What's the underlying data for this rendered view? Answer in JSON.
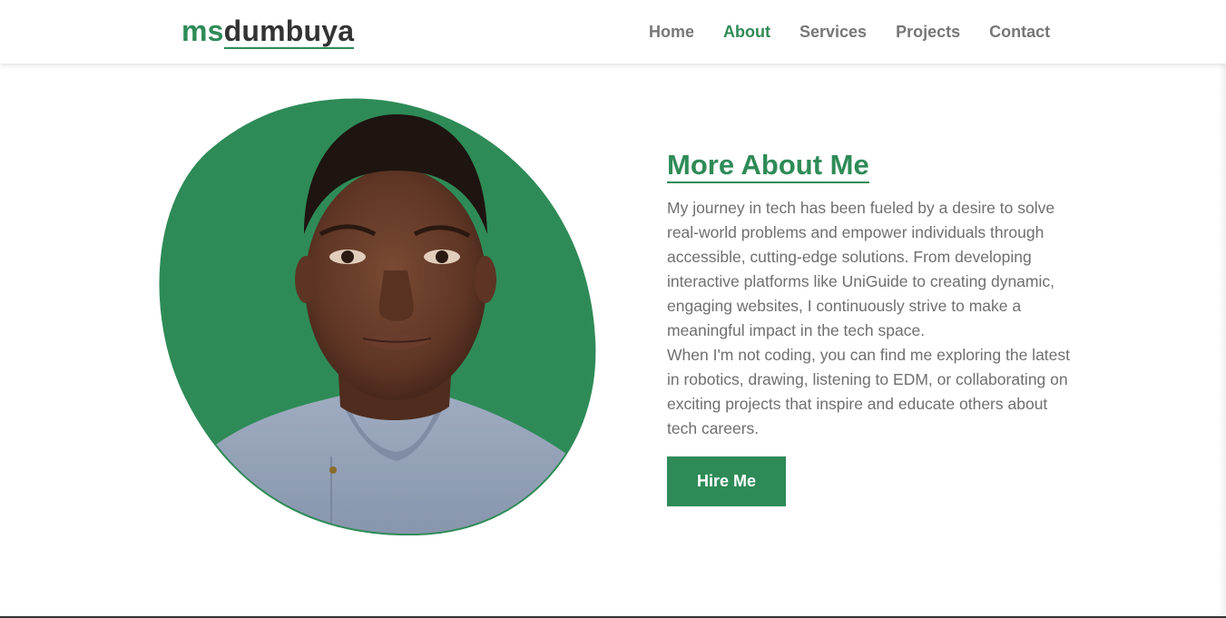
{
  "brand": {
    "logo_part1": "ms",
    "logo_part2": "dumbuya"
  },
  "nav": {
    "items": [
      {
        "label": "Home",
        "active": false
      },
      {
        "label": "About",
        "active": true
      },
      {
        "label": "Services",
        "active": false
      },
      {
        "label": "Projects",
        "active": false
      },
      {
        "label": "Contact",
        "active": false
      }
    ]
  },
  "about": {
    "title": "More About Me",
    "paragraph1": "My journey in tech has been fueled by a desire to solve real-world problems and empower individuals through accessible, cutting-edge solutions. From developing interactive platforms like UniGuide to creating dynamic, engaging websites, I continuously strive to make a meaningful impact in the tech space.",
    "paragraph2": "When I'm not coding, you can find me exploring the latest in robotics, drawing, listening to EDM, or collaborating on exciting projects that inspire and educate others about tech careers.",
    "cta_label": "Hire Me"
  },
  "colors": {
    "accent": "#2e8b57",
    "text_dark": "#333333",
    "text_muted": "#6f6f6f",
    "nav_muted": "#777777"
  },
  "icons": {
    "profile_photo": "profile-portrait"
  }
}
